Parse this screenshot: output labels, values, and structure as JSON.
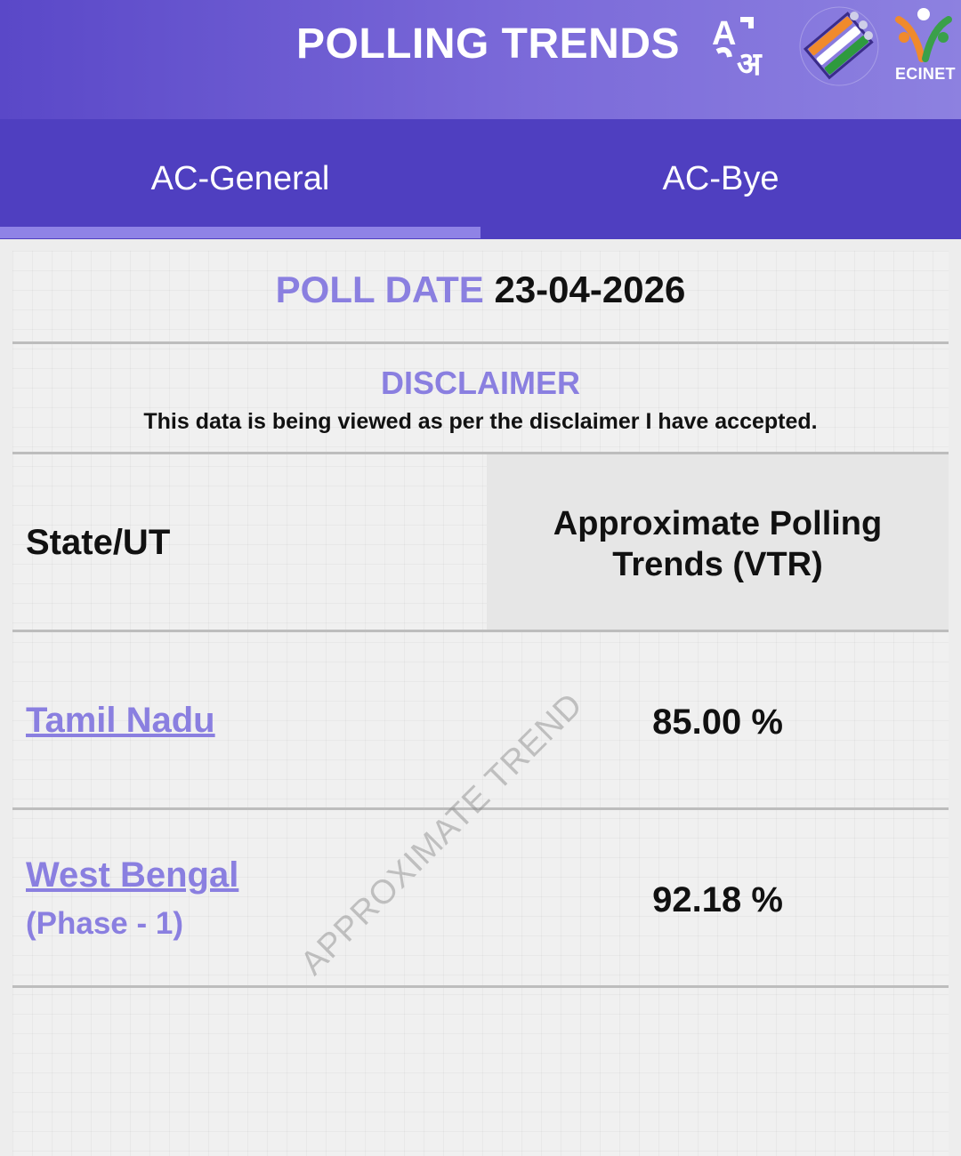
{
  "header": {
    "title": "POLLING TRENDS",
    "logos": [
      "language-toggle-icon",
      "eci-logo",
      "ecinet-logo"
    ],
    "ecinet_label": "ECINET"
  },
  "tabs": [
    {
      "label": "AC-General",
      "active": true
    },
    {
      "label": "AC-Bye",
      "active": false
    }
  ],
  "poll": {
    "date_label": "POLL DATE",
    "date_value": "23-04-2026"
  },
  "disclaimer": {
    "title": "DISCLAIMER",
    "text": "This data is being viewed as per the disclaimer I have accepted."
  },
  "table": {
    "headers": {
      "state": "State/UT",
      "vtr_line1": "Approximate Polling",
      "vtr_line2": "Trends (VTR)"
    },
    "rows": [
      {
        "state": "Tamil Nadu",
        "sub": "",
        "vtr": "85.00 %"
      },
      {
        "state": "West Bengal",
        "sub": "(Phase - 1)",
        "vtr": "92.18 %"
      }
    ]
  },
  "watermark": "APPROXIMATE TREND",
  "colors": {
    "header": "#5a48c8",
    "tabs": "#4f3fc0",
    "accent": "#8a7fe0"
  }
}
